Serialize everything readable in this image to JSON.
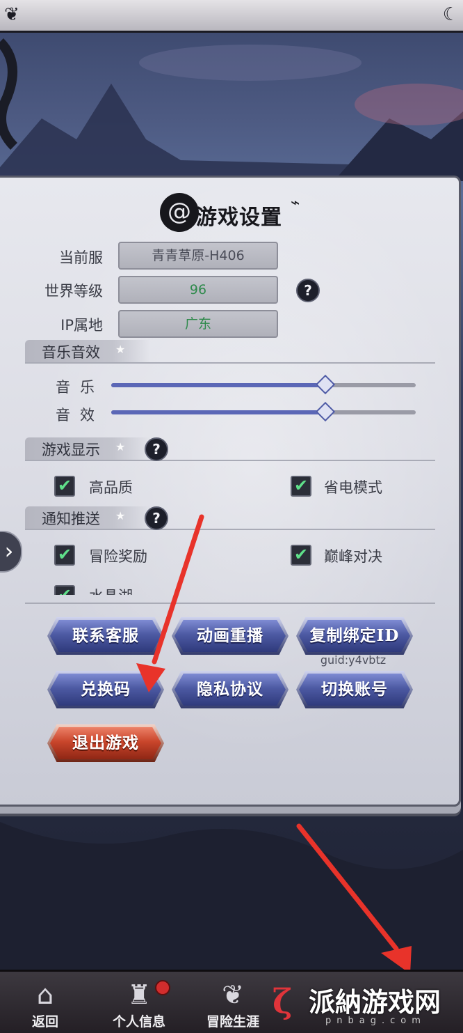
{
  "title": "游戏设置",
  "fields": [
    {
      "label": "当前服",
      "value": "青青草原-H406",
      "color": "#4a4c58"
    },
    {
      "label": "世界等级",
      "value": "96",
      "color": "#2f8a4c"
    },
    {
      "label": "IP属地",
      "value": "广东",
      "color": "#2f8a4c"
    }
  ],
  "sections": {
    "audio": "音乐音效",
    "display": "游戏显示",
    "notify": "通知推送"
  },
  "sliders": [
    {
      "label": "音乐",
      "value_fraction": 0.7
    },
    {
      "label": "音效",
      "value_fraction": 0.7
    }
  ],
  "display_options": [
    {
      "label": "高品质",
      "checked": true
    },
    {
      "label": "省电模式",
      "checked": true
    }
  ],
  "notify_options": [
    {
      "label": "冒险奖励",
      "checked": true
    },
    {
      "label": "巅峰对决",
      "checked": true
    },
    {
      "label": "水晶湖",
      "checked": true
    }
  ],
  "buttons": {
    "contact": "联系客服",
    "replay": "动画重播",
    "copy_id": "复制绑定ID",
    "redeem": "兑换码",
    "privacy": "隐私协议",
    "switch_account": "切换账号",
    "quit": "退出游戏"
  },
  "guid": "guid:y4vbtz",
  "bottom_nav": [
    {
      "label": "返回",
      "icon": "back-icon"
    },
    {
      "label": "个人信息",
      "icon": "castle-icon"
    },
    {
      "label": "冒险生涯",
      "icon": "wings-emblem-icon"
    }
  ],
  "watermark": {
    "text": "派納游戏网",
    "sub": "pnbag.com"
  }
}
